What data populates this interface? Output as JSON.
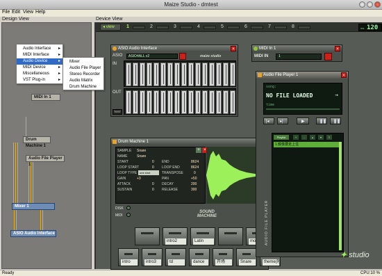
{
  "window": {
    "title": "Maize Studio - dmtest"
  },
  "menubar": {
    "file": "File",
    "edit": "Edit",
    "view": "View",
    "help": "Help"
  },
  "design_view": {
    "label": "Design View",
    "context_menu": [
      "Audio Interface",
      "MIDI Interface",
      "Audio Device",
      "MIDI Device",
      "Miscellaneous",
      "VST Plug-in"
    ],
    "submenu": [
      "Mixer",
      "Audio File Player",
      "Stereo Recorder",
      "Audio Matrix",
      "Drum Machine"
    ],
    "nodes": {
      "midi_in": "MIDI In 1",
      "drum": "Drum Machine 1",
      "player": "Audio File Player 1",
      "mixer": "Mixer 1",
      "asio": "ASIO Audio Interface"
    }
  },
  "device_view": {
    "label": "Device View",
    "view_tab": "view",
    "tabs": [
      "1",
      "2",
      "3",
      "4",
      "5",
      "6",
      "7",
      "8"
    ],
    "tempo": "120",
    "tempo_suffix": "ms"
  },
  "asio": {
    "title": "ASIO Audio Interface",
    "asio_label": "ASIO",
    "driver": "ASIO4ALL v2",
    "brand": "maize studio",
    "in_label": "IN",
    "out_label": "OUT",
    "test_label": "TEST"
  },
  "midi_in": {
    "title": "MIDI In 1",
    "label": "MIDI IN",
    "value": "1"
  },
  "player": {
    "title": "Audio File Player 1",
    "song_label": "song:",
    "song": "NO FILE LOADED",
    "time_label": "time",
    "playlist_label": "Playlist",
    "playlist_item": "1.鏡像要走上住",
    "vertical_label": "AUDIO FILE PLAYER"
  },
  "drum": {
    "title": "Drum Machine 1",
    "sample_label": "SAMPLE",
    "sample": "Snare",
    "name_label": "NAME",
    "name": "Snare",
    "start_label": "START",
    "start": "0",
    "end_label": "END",
    "end": "8624",
    "loop_start_label": "LOOP START",
    "loop_start": "0",
    "loop_end_label": "LOOP END",
    "loop_end": "8624",
    "loop_type_label": "LOOP TYPE",
    "loop_type": "one shot",
    "transpose_label": "TRANSPOSE",
    "transpose": "0",
    "gain_label": "GAIN",
    "gain": "+3",
    "pan_label": "PAN",
    "pan": "+50",
    "attack_label": "ATTACK",
    "attack": "0",
    "decay_label": "DECAY",
    "decay": "200",
    "sustain_label": "SUSTAIN",
    "sustain": "0",
    "release_label": "RELEASE",
    "release": "300",
    "disk_label": "DISK",
    "midi_label": "MIDI",
    "pads_top": [
      "",
      "intro2",
      "Latin",
      "",
      "mouse",
      ""
    ],
    "pads_bottom": [
      "intro",
      "intro3",
      "td",
      "dance",
      "开场",
      "Snare",
      "theme(短"
    ],
    "logo": "SOUND MACHINE"
  },
  "brand": {
    "logo": "studio"
  },
  "status": {
    "left": "Ready",
    "cpu": "CPU:10 %"
  }
}
